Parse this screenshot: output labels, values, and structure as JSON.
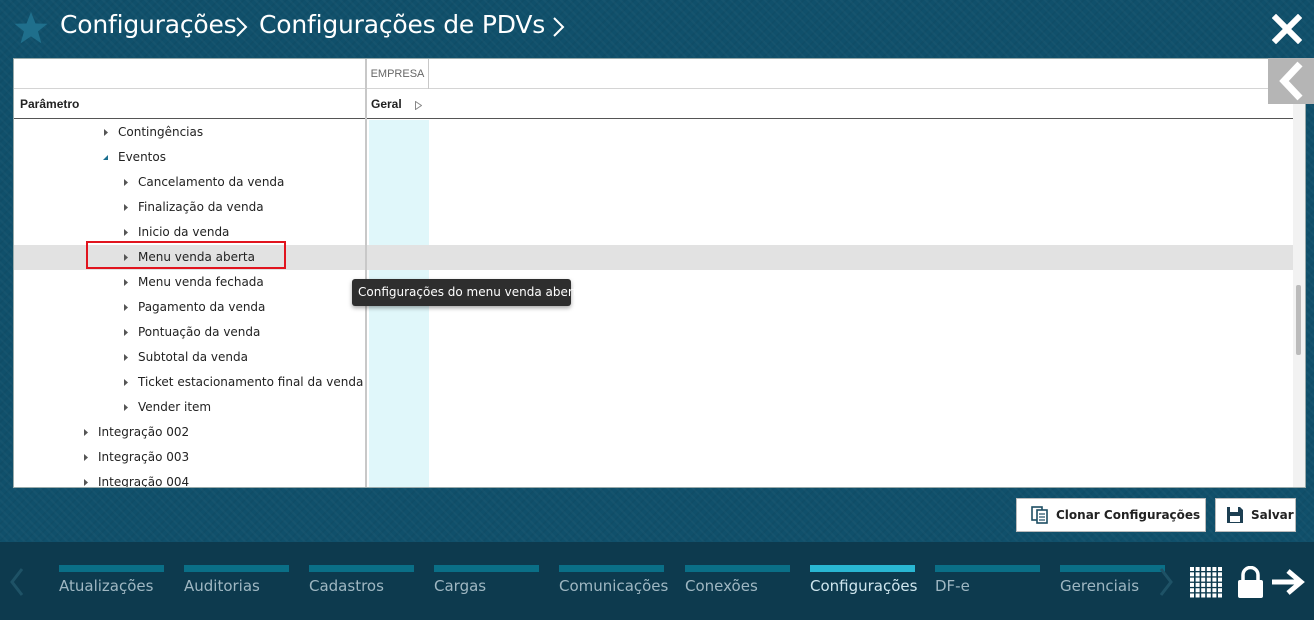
{
  "header": {
    "breadcrumb": [
      "Configurações",
      "Configurações de PDVs"
    ]
  },
  "table": {
    "group_header": "EMPRESA",
    "col_param": "Parâmetro",
    "col_geral": "Geral",
    "rows": [
      {
        "label": "Contingências",
        "indent": 1,
        "expanded": false
      },
      {
        "label": "Eventos",
        "indent": 1,
        "expanded": true
      },
      {
        "label": "Cancelamento da venda",
        "indent": 2,
        "expanded": false
      },
      {
        "label": "Finalização da venda",
        "indent": 2,
        "expanded": false
      },
      {
        "label": "Inicio da venda",
        "indent": 2,
        "expanded": false
      },
      {
        "label": "Menu venda aberta",
        "indent": 2,
        "expanded": false,
        "selected": true
      },
      {
        "label": "Menu venda fechada",
        "indent": 2,
        "expanded": false
      },
      {
        "label": "Pagamento da venda",
        "indent": 2,
        "expanded": false
      },
      {
        "label": "Pontuação da venda",
        "indent": 2,
        "expanded": false
      },
      {
        "label": "Subtotal da venda",
        "indent": 2,
        "expanded": false
      },
      {
        "label": "Ticket estacionamento final da venda",
        "indent": 2,
        "expanded": false
      },
      {
        "label": "Vender item",
        "indent": 2,
        "expanded": false
      },
      {
        "label": "Integração 002",
        "indent": 0,
        "expanded": false
      },
      {
        "label": "Integração 003",
        "indent": 0,
        "expanded": false
      },
      {
        "label": "Integração 004",
        "indent": 0,
        "expanded": false
      }
    ]
  },
  "tooltip": "Configurações do menu venda aberta",
  "buttons": {
    "clone": "Clonar Configurações",
    "save": "Salvar"
  },
  "nav": {
    "items": [
      "Atualizações",
      "Auditorias",
      "Cadastros",
      "Cargas",
      "Comunicações",
      "Conexões",
      "Configurações",
      "DF-e",
      "Gerenciais"
    ],
    "active": "Configurações"
  },
  "colors": {
    "background": "#10506b",
    "nav_background": "#0d3a4e",
    "nav_bar": "#0a6f87",
    "nav_bar_active": "#29b7d3",
    "highlight_border": "#e1141e",
    "column_tint": "#e0f7fa",
    "tooltip_bg": "#2e2e2e"
  },
  "icons": {
    "header": [
      "star-icon",
      "chevron-right-icon",
      "close-icon"
    ],
    "buttons": [
      "clone-icon",
      "floppy-disk-icon"
    ],
    "nav": [
      "chevron-left-icon",
      "chevron-right-icon",
      "grid-icon",
      "lock-icon",
      "arrow-right-icon"
    ]
  }
}
